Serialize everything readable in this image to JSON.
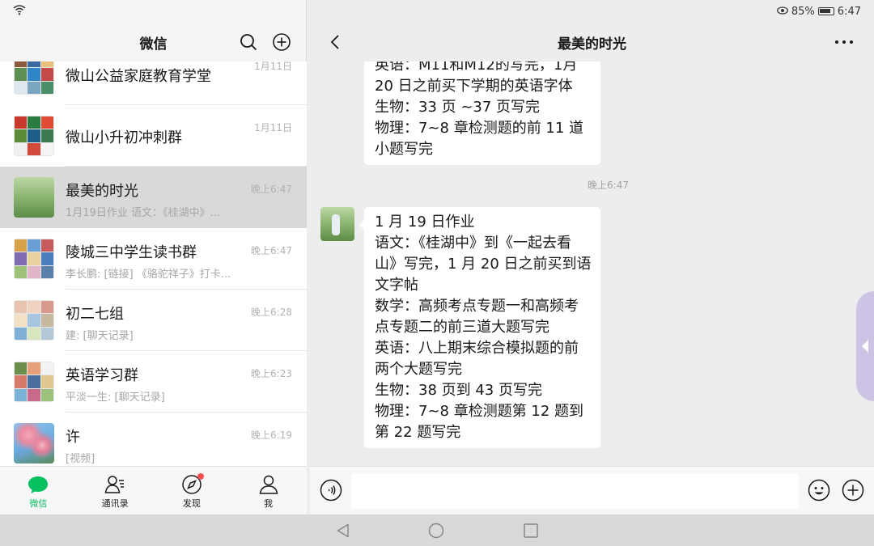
{
  "status_bar": {
    "battery_percent": "85%",
    "time": "6:47"
  },
  "left_panel": {
    "title": "微信",
    "chats": [
      {
        "name": "微山公益家庭教育学堂",
        "preview": "",
        "time": "1月11日",
        "avatar_colors": [
          "#8b5a3c",
          "#3b6aa0",
          "#e8c07a",
          "#5d8f52",
          "#2f86c9",
          "#c44a4a",
          "#dfe7ef",
          "#7aa6c2",
          "#4a8f6a"
        ]
      },
      {
        "name": "微山小升初冲刺群",
        "preview": "",
        "time": "1月11日",
        "avatar_colors": [
          "#c9382d",
          "#2b7a3f",
          "#e04b35",
          "#5b8c3a",
          "#1e5f8a",
          "#3c7a4f",
          "#f0f0f0",
          "#d24a3c",
          "#f4f4f4"
        ]
      },
      {
        "name": "最美的时光",
        "preview": "1月19日作业 语文：《桂湖中》...",
        "time": "晚上6:47",
        "active": true,
        "single_avatar": true
      },
      {
        "name": "陵城三中学生读书群",
        "preview": "李长鹏: [链接] 《骆驼祥子》打卡...",
        "time": "晚上6:47",
        "avatar_colors": [
          "#d8a24a",
          "#6a9fd4",
          "#c65b5b",
          "#7f6bb0",
          "#e8d2a0",
          "#4a7fbf",
          "#9fc27a",
          "#e0b6c8",
          "#5a7fa8"
        ]
      },
      {
        "name": "初二七组",
        "preview": "建: [聊天记录]",
        "time": "晚上6:28",
        "avatar_colors": [
          "#e8c4b0",
          "#f0d2c0",
          "#d89a8c",
          "#f3e1c5",
          "#a8c5e0",
          "#c8b8a0",
          "#7fb0d8",
          "#d8e6c0",
          "#b4c8d8"
        ]
      },
      {
        "name": "英语学习群",
        "preview": "平淡一生: [聊天记录]",
        "time": "晚上6:23",
        "avatar_colors": [
          "#6b8f4a",
          "#e8a078",
          "#f3f3f3",
          "#d87a6a",
          "#4a6f9f",
          "#e0c890",
          "#7ab2d8",
          "#c96a8a",
          "#9ac27a"
        ]
      },
      {
        "name": "许",
        "preview": "[视频]",
        "time": "晚上6:19",
        "single_avatar": true,
        "avatar_style": "blossom"
      }
    ]
  },
  "bottom_nav": [
    {
      "label": "微信",
      "icon": "chat-bubble-icon",
      "active": true
    },
    {
      "label": "通讯录",
      "icon": "contacts-icon"
    },
    {
      "label": "发现",
      "icon": "compass-icon",
      "badge": true
    },
    {
      "label": "我",
      "icon": "person-icon"
    }
  ],
  "chat": {
    "title": "最美的时光",
    "message_time": "晚上6:47",
    "message_1_lines": [
      "英语：M11和M12的写完，1月",
      "20 日之前买下学期的英语字体",
      "生物：33 页 ~37 页写完",
      "物理：7~8 章检测题的前 11 道",
      "小题写完"
    ],
    "message_2_lines": [
      "1 月 19 日作业",
      "语文：《桂湖中》到《一起去看",
      "山》写完，1 月 20 日之前买到语",
      "文字帖",
      "数学：高频考点专题一和高频考",
      "点专题二的前三道大题写完",
      "英语：八上期末综合模拟题的前",
      "两个大题写完",
      "生物：38 页到 43 页写完",
      "物理：7~8 章检测题第 12 题到",
      "第 22 题写完"
    ]
  },
  "input_bar": {
    "value": ""
  },
  "colors": {
    "accent": "#07c160",
    "badge": "#fa5151",
    "active_row": "#d9d9d9"
  }
}
